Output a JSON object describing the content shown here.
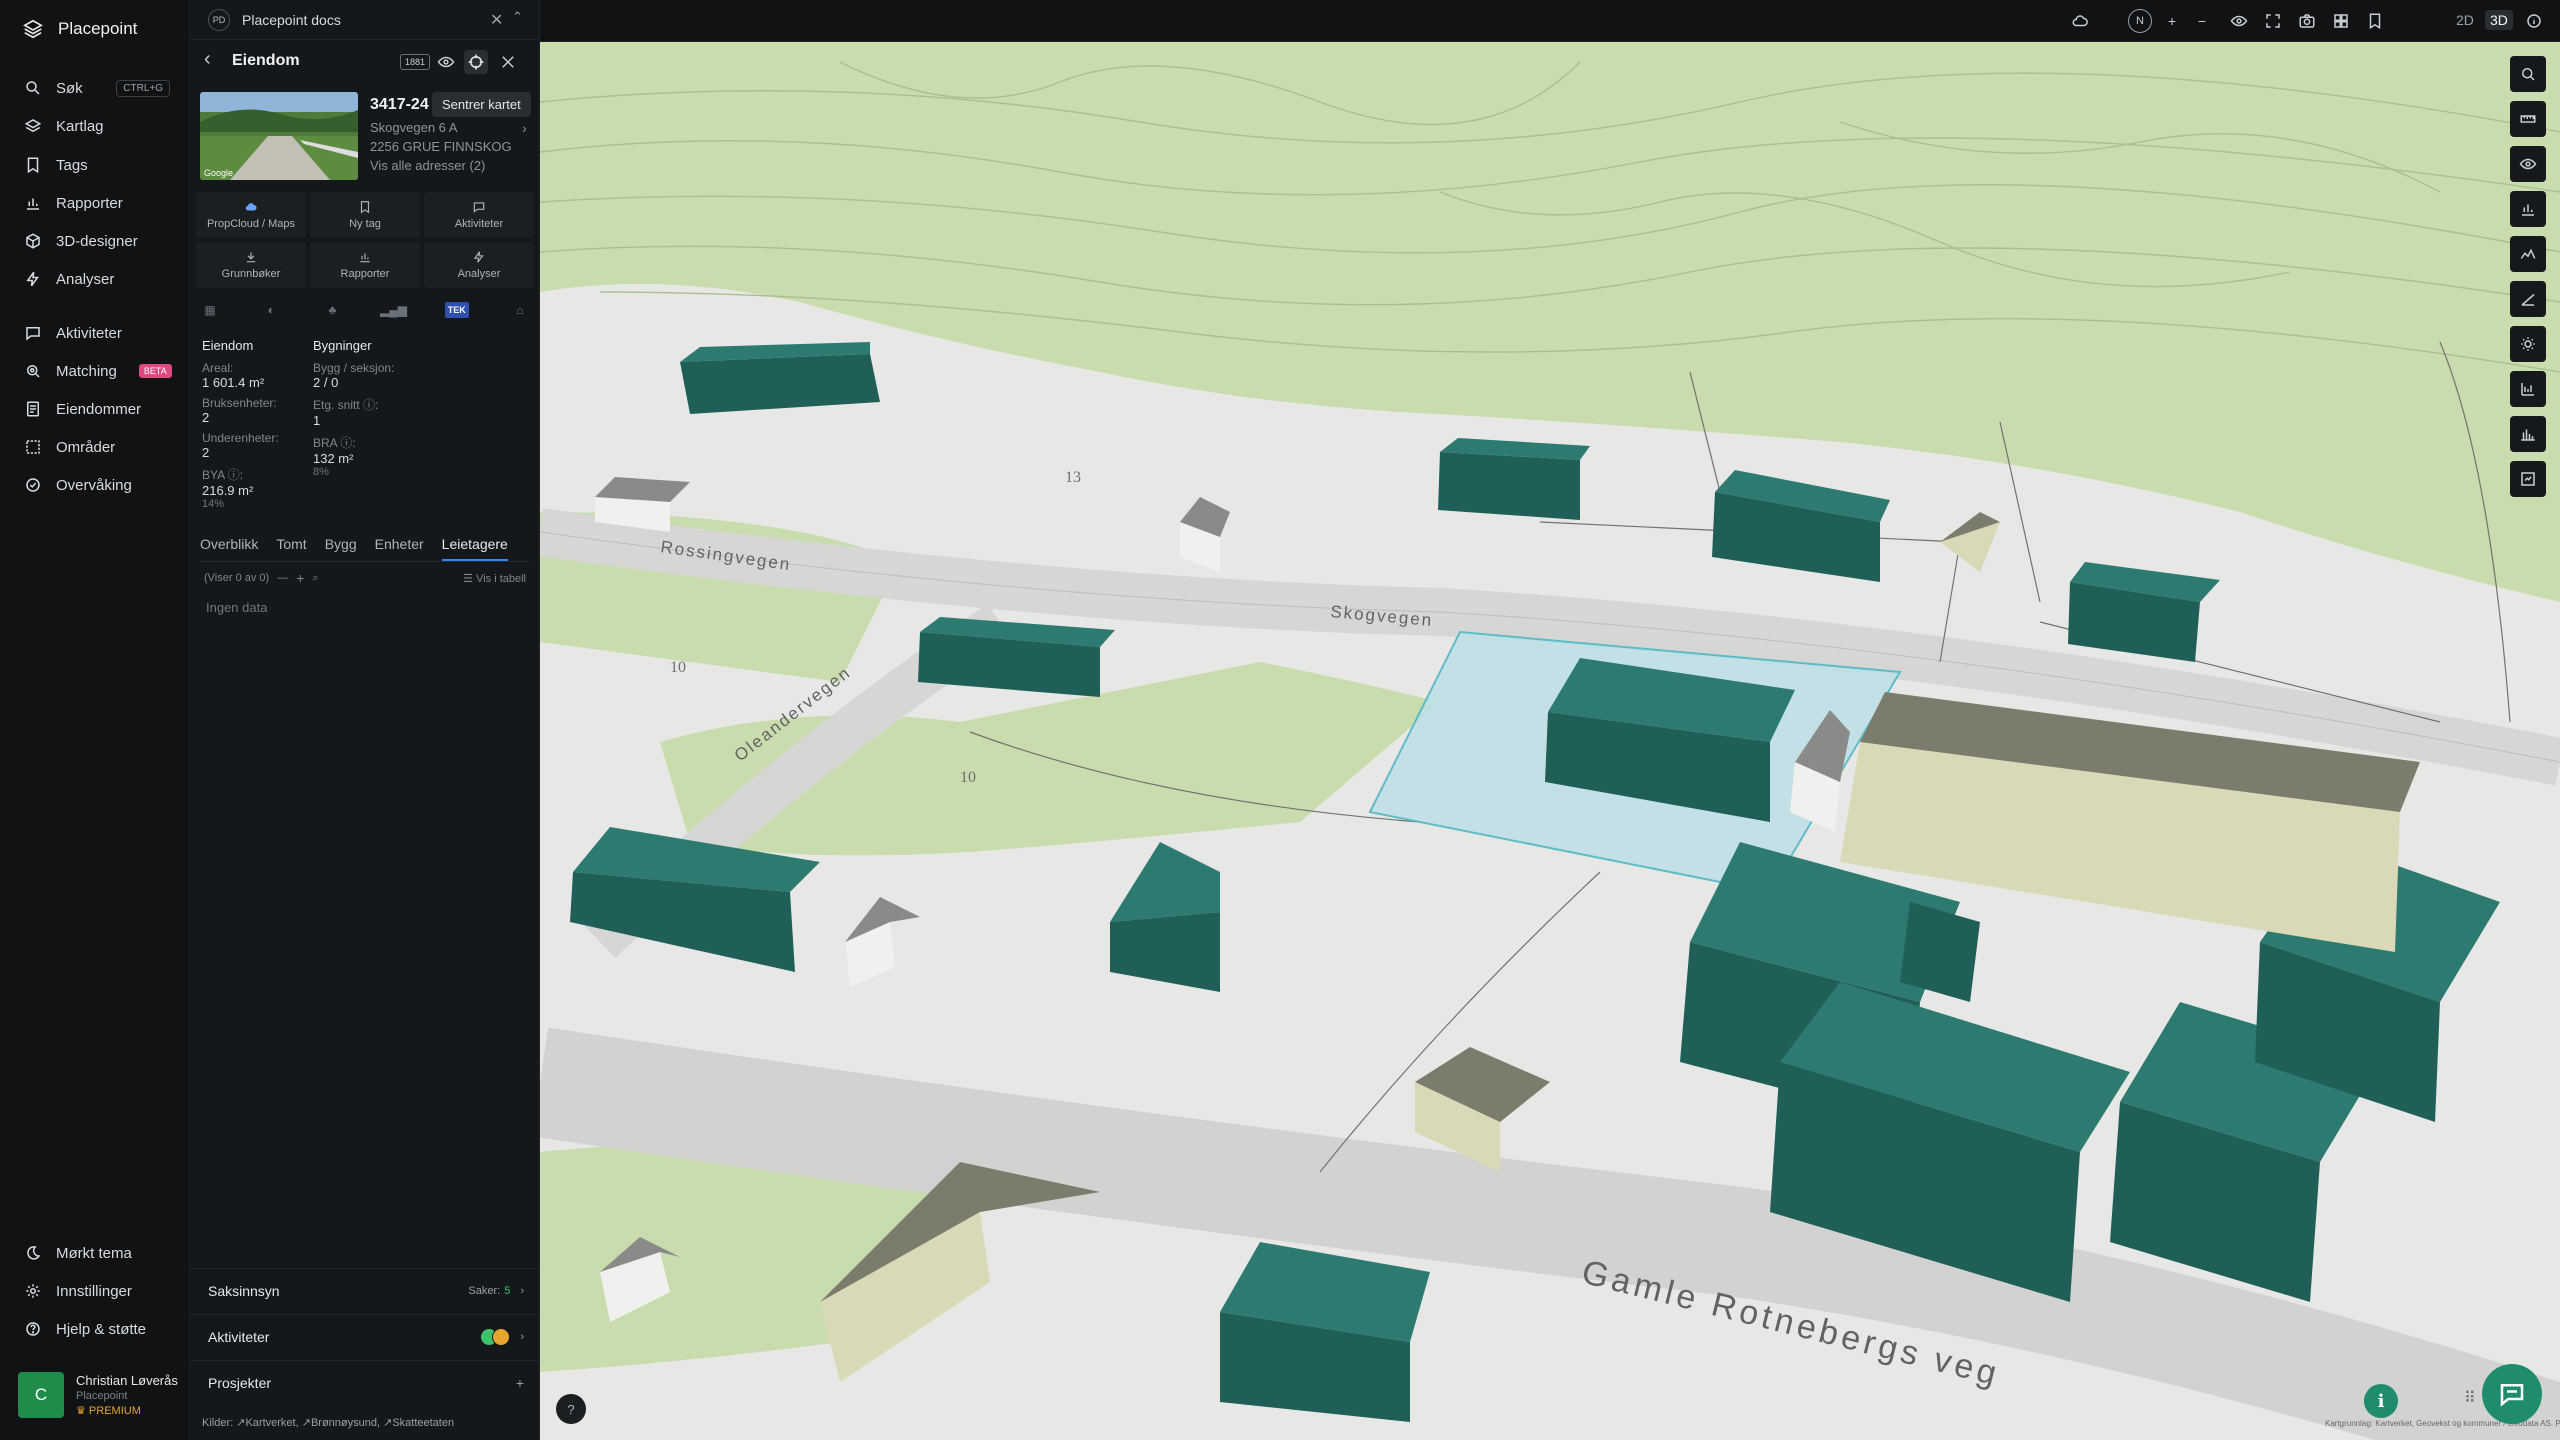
{
  "app": {
    "name": "Placepoint",
    "doc_tab_title": "Placepoint docs",
    "doc_tab_badge": "PD"
  },
  "nav": {
    "items": [
      {
        "label": "Søk",
        "kbd": "CTRL+G"
      },
      {
        "label": "Kartlag"
      },
      {
        "label": "Tags"
      },
      {
        "label": "Rapporter"
      },
      {
        "label": "3D-designer"
      },
      {
        "label": "Analyser"
      },
      {
        "label": "Aktiviteter"
      },
      {
        "label": "Matching",
        "badge": "BETA"
      },
      {
        "label": "Eiendommer"
      },
      {
        "label": "Områder"
      },
      {
        "label": "Overvåking"
      }
    ],
    "bottom": [
      {
        "label": "Mørkt tema"
      },
      {
        "label": "Innstillinger"
      },
      {
        "label": "Hjelp & støtte"
      }
    ],
    "user": {
      "initial": "C",
      "name": "Christian Løverås",
      "org": "Placepoint",
      "plan": "PREMIUM"
    }
  },
  "panel": {
    "title": "Eiendom",
    "badge_1881": "1881",
    "tooltip": "Sentrer kartet",
    "property_id": "3417-24",
    "address_line1": "Skogvegen 6 A",
    "address_line2": "2256 GRUE FINNSKOG",
    "all_addresses": "Vis alle adresser (2)",
    "photo_watermark": "Google",
    "actions": [
      "PropCloud / Maps",
      "Ny tag",
      "Aktiviteter",
      "Grunnbøker",
      "Rapporter",
      "Analyser"
    ],
    "tek_badge": "TEK",
    "stats": {
      "col1_header": "Eiendom",
      "col2_header": "Bygninger",
      "areal_label": "Areal:",
      "areal_value": "1 601.4 m²",
      "bruksenheter_label": "Bruksenheter:",
      "bruksenheter_value": "2",
      "underenheter_label": "Underenheter:",
      "underenheter_value": "2",
      "bya_label": "BYA ⓘ:",
      "bya_value": "216.9 m²",
      "bya_pct": "14%",
      "bygg_label": "Bygg / seksjon:",
      "bygg_value": "2 / 0",
      "etg_label": "Etg. snitt ⓘ:",
      "etg_value": "1",
      "bra_label": "BRA ⓘ:",
      "bra_value": "132 m²",
      "bra_pct": "8%"
    },
    "subtabs": [
      "Overblikk",
      "Tomt",
      "Bygg",
      "Enheter",
      "Leietagere"
    ],
    "active_subtab": "Leietagere",
    "list_count": "(Viser 0 av 0)",
    "view_table": "Vis i tabell",
    "no_data": "Ingen data",
    "sections": {
      "saksinnsyn": "Saksinnsyn",
      "saker_label": "Saker:",
      "saker_count": "5",
      "aktiviteter": "Aktiviteter",
      "prosjekter": "Prosjekter"
    },
    "sources_label": "Kilder:",
    "sources": [
      "Kartverket,",
      "Brønnøysund,",
      "Skatteetaten"
    ]
  },
  "topbar": {
    "compass": "N",
    "mode_2d": "2D",
    "mode_3d": "3D",
    "active_mode": "3D"
  },
  "map": {
    "street_labels": [
      "Rossingvegen",
      "Skogvegen",
      "Oleandervegen",
      "Gamle Rotnebergs veg"
    ],
    "contour_labels": [
      "13",
      "10",
      "10"
    ],
    "attribution": "Kartgrunnlag: Kartverket, Geovekst og kommuner / Geodata AS. Powered by Esri"
  },
  "colors": {
    "accent": "#2d8cf0",
    "building": "#1e5b56",
    "green": "#1f8c6e",
    "beta": "#e0487f"
  }
}
